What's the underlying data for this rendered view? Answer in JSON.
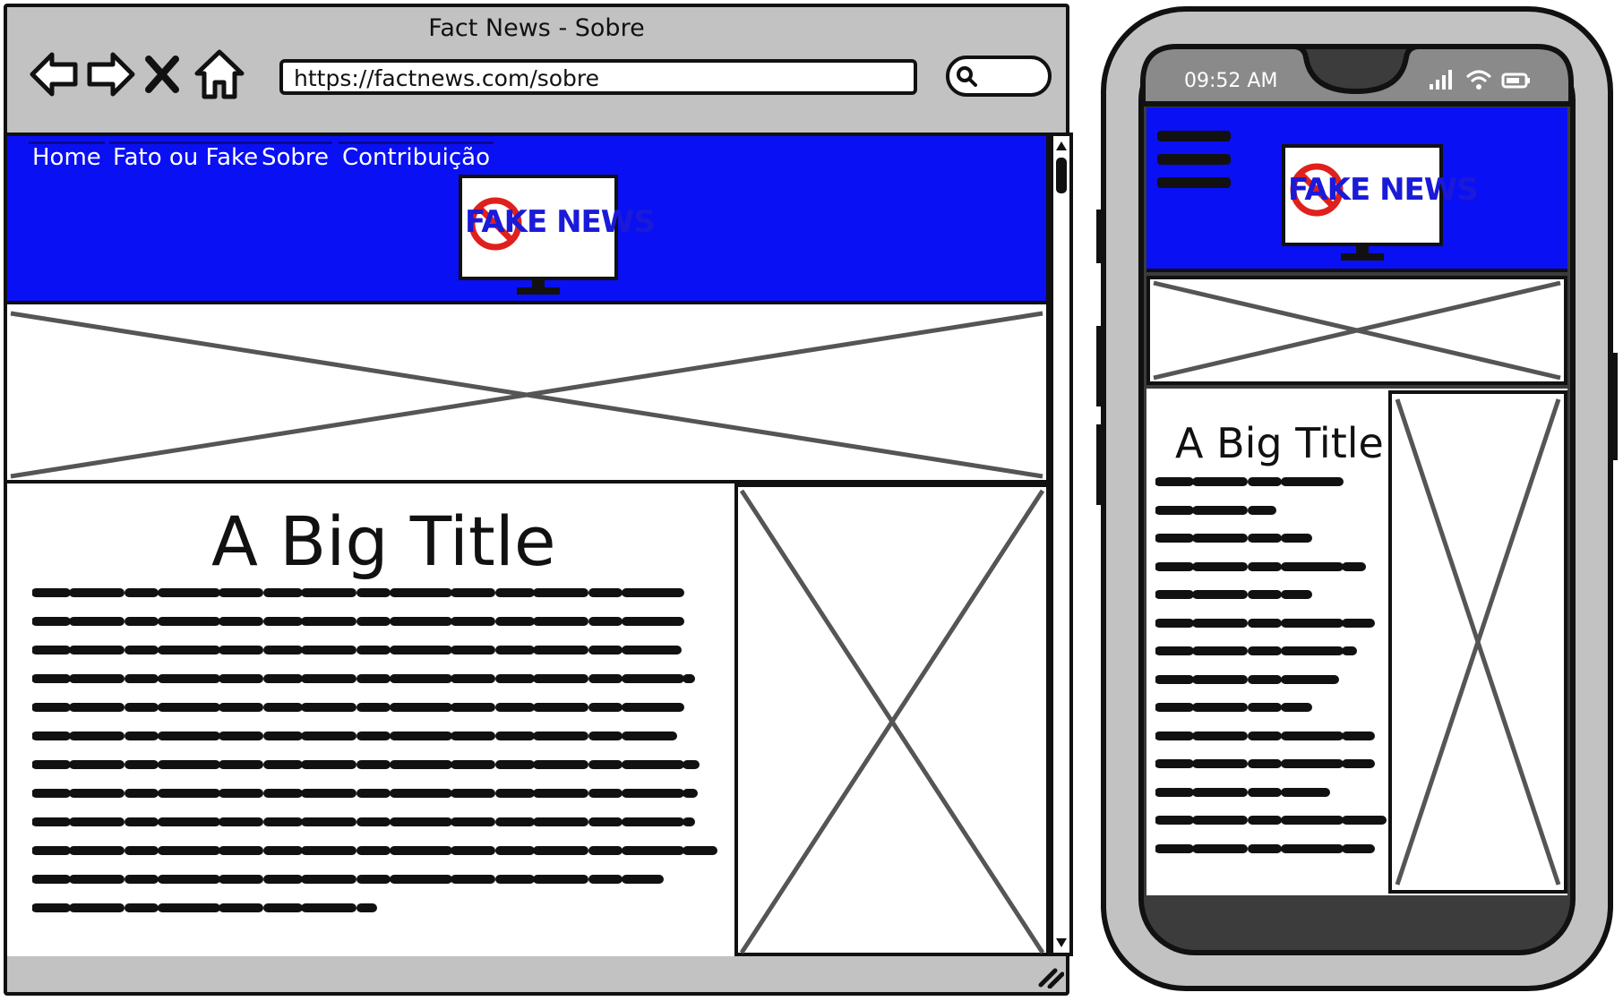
{
  "browser": {
    "title": "Fact News - Sobre",
    "url": "https://factnews.com/sobre",
    "search_placeholder": ""
  },
  "site": {
    "menu": [
      "Home",
      "Fato ou Fake",
      "Sobre",
      "Contribuição"
    ],
    "logo_text_first": "FAKE",
    "logo_text_second": "NEWS",
    "content_title": "A Big Title"
  },
  "phone": {
    "time": "09:52 AM",
    "content_title": "A Big Title"
  },
  "colors": {
    "header_blue": "#0a10f4",
    "frame_gray": "#c2c2c2",
    "logo_text_blue": "#1a1ad8",
    "no_sign_red": "#e0201c"
  },
  "icons": [
    "back-arrow-icon",
    "forward-arrow-icon",
    "stop-x-icon",
    "home-icon",
    "search-icon",
    "hamburger-menu-icon",
    "signal-icon",
    "wifi-icon",
    "battery-icon",
    "resize-grip-icon"
  ]
}
